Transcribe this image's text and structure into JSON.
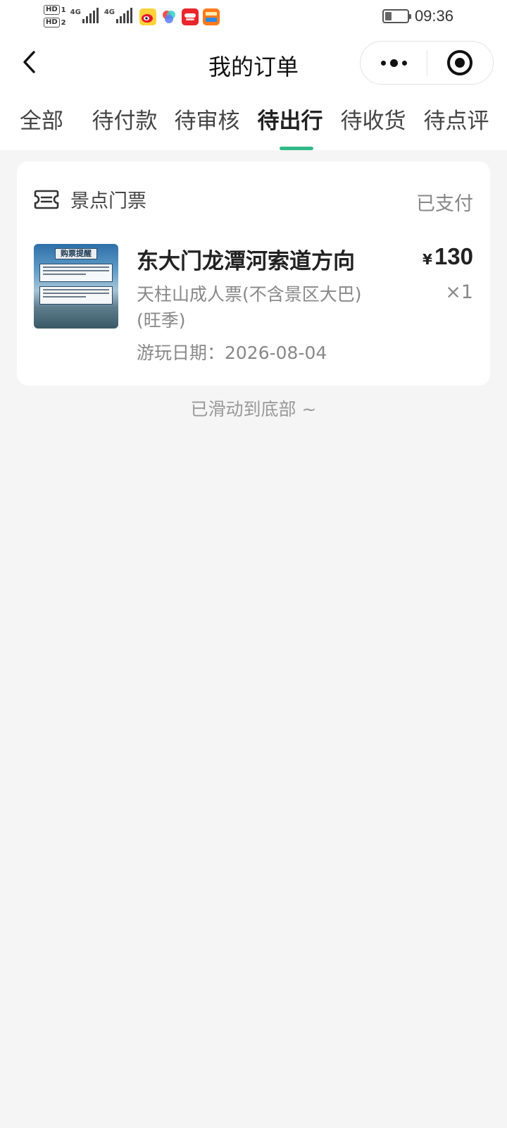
{
  "status_bar": {
    "sim1": "HD",
    "sim1_index": "1",
    "sim2": "HD",
    "sim2_index": "2",
    "net1": "4G",
    "net2": "4G",
    "time": "09:36",
    "app_icons": [
      "weibo-icon",
      "colorful-app-icon",
      "red-app-icon",
      "orange-app-icon"
    ]
  },
  "nav": {
    "title": "我的订单",
    "back_icon": "chevron-left-icon",
    "more_icon": "more-dots-icon",
    "close_icon": "target-circle-icon"
  },
  "tabs": [
    {
      "label": "全部",
      "active": false
    },
    {
      "label": "待付款",
      "active": false
    },
    {
      "label": "待审核",
      "active": false
    },
    {
      "label": "待出行",
      "active": true
    },
    {
      "label": "待收货",
      "active": false
    },
    {
      "label": "待点评",
      "active": false
    }
  ],
  "accent_color": "#2fb888",
  "order": {
    "category": "景点门票",
    "category_icon": "ticket-icon",
    "status": "已支付",
    "thumbnail_heading": "购票提醒",
    "title": "东大门龙潭河索道方向",
    "currency": "¥",
    "price": "130",
    "spec": "天柱山成人票(不含景区大巴)(旺季)",
    "quantity": "×1",
    "date_text": "游玩日期：2026-08-04"
  },
  "footer": {
    "tip": "已滑动到底部 ~"
  }
}
